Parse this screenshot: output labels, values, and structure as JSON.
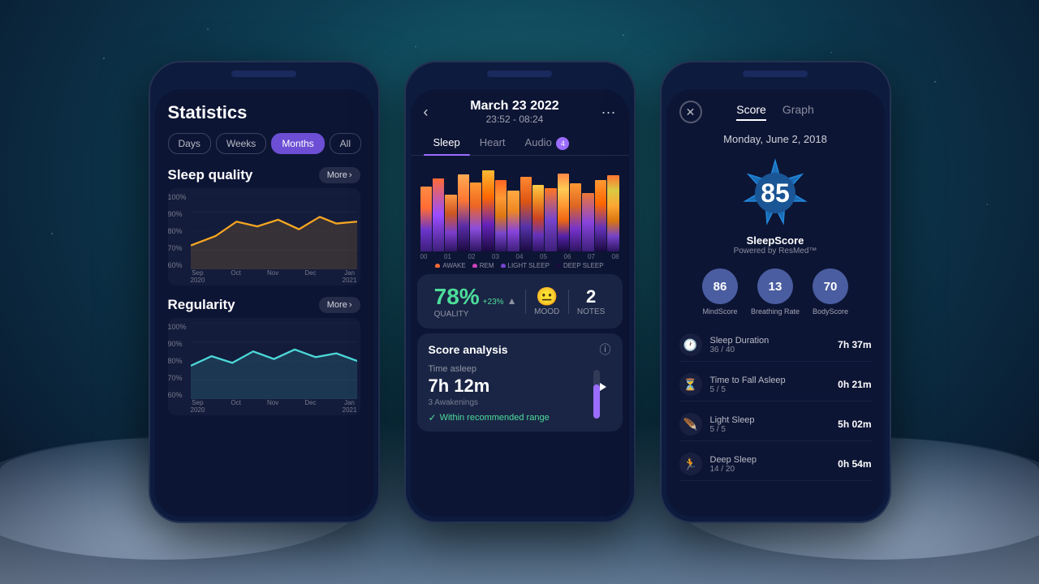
{
  "background": {
    "color": "#0d1535"
  },
  "phone1": {
    "title": "Statistics",
    "tabs": [
      "Days",
      "Weeks",
      "Months",
      "All"
    ],
    "active_tab": "Months",
    "sections": [
      {
        "name": "Sleep quality",
        "more_label": "More",
        "y_labels": [
          "100%",
          "90%",
          "80%",
          "70%",
          "60%"
        ],
        "x_labels": [
          {
            "line1": "Sep",
            "line2": "2020"
          },
          {
            "line1": "Oct",
            "line2": ""
          },
          {
            "line1": "Nov",
            "line2": ""
          },
          {
            "line1": "Dec",
            "line2": ""
          },
          {
            "line1": "Jan",
            "line2": "2021"
          }
        ]
      },
      {
        "name": "Regularity",
        "more_label": "More",
        "y_labels": [
          "100%",
          "90%",
          "80%",
          "70%",
          "60%"
        ],
        "x_labels": [
          {
            "line1": "Sep",
            "line2": "2020"
          },
          {
            "line1": "Oct",
            "line2": ""
          },
          {
            "line1": "Nov",
            "line2": ""
          },
          {
            "line1": "Dec",
            "line2": ""
          },
          {
            "line1": "Jan",
            "line2": "2021"
          }
        ]
      }
    ]
  },
  "phone2": {
    "date": "March 23 2022",
    "time_range": "23:52 - 08:24",
    "tabs": [
      "Sleep",
      "Heart",
      "Audio"
    ],
    "audio_badge": "4",
    "quality": {
      "percent": "78%",
      "change": "+23%",
      "label": "QUALITY"
    },
    "mood": {
      "emoji": "😐",
      "label": "MOOD"
    },
    "notes": {
      "count": "2",
      "label": "NOTES"
    },
    "score_analysis": {
      "title": "Score analysis",
      "time_asleep_label": "Time asleep",
      "time_asleep_value": "7h 12m",
      "awakenings": "3 Awakenings",
      "range_text": "Within recommended range"
    },
    "chart_labels": [
      "00",
      "01",
      "02",
      "03",
      "04",
      "05",
      "06",
      "07",
      "08"
    ],
    "legend": [
      "AWAKE",
      "REM",
      "LIGHT SLEEP",
      "DEEP SLEEP"
    ]
  },
  "phone3": {
    "tabs": [
      "Score",
      "Graph"
    ],
    "active_tab": "Score",
    "date": "Monday, June 2, 2018",
    "sleep_score": "85",
    "sleep_score_label": "SleepScore",
    "powered_by": "Powered by ResMed™",
    "sub_scores": [
      {
        "label": "MindScore",
        "value": "86"
      },
      {
        "label": "Breathing Rate",
        "value": "13"
      },
      {
        "label": "BodyScore",
        "value": "70"
      }
    ],
    "metrics": [
      {
        "icon": "🕐",
        "name": "Sleep Duration",
        "score": "36 / 40",
        "value": "7h 37m"
      },
      {
        "icon": "⏳",
        "name": "Time to Fall Asleep",
        "score": "5 / 5",
        "value": "0h 21m"
      },
      {
        "icon": "🪶",
        "name": "Light Sleep",
        "score": "5 / 5",
        "value": "5h 02m"
      },
      {
        "icon": "🏃",
        "name": "Deep Sleep",
        "score": "14 / 20",
        "value": "0h 54m"
      }
    ]
  }
}
